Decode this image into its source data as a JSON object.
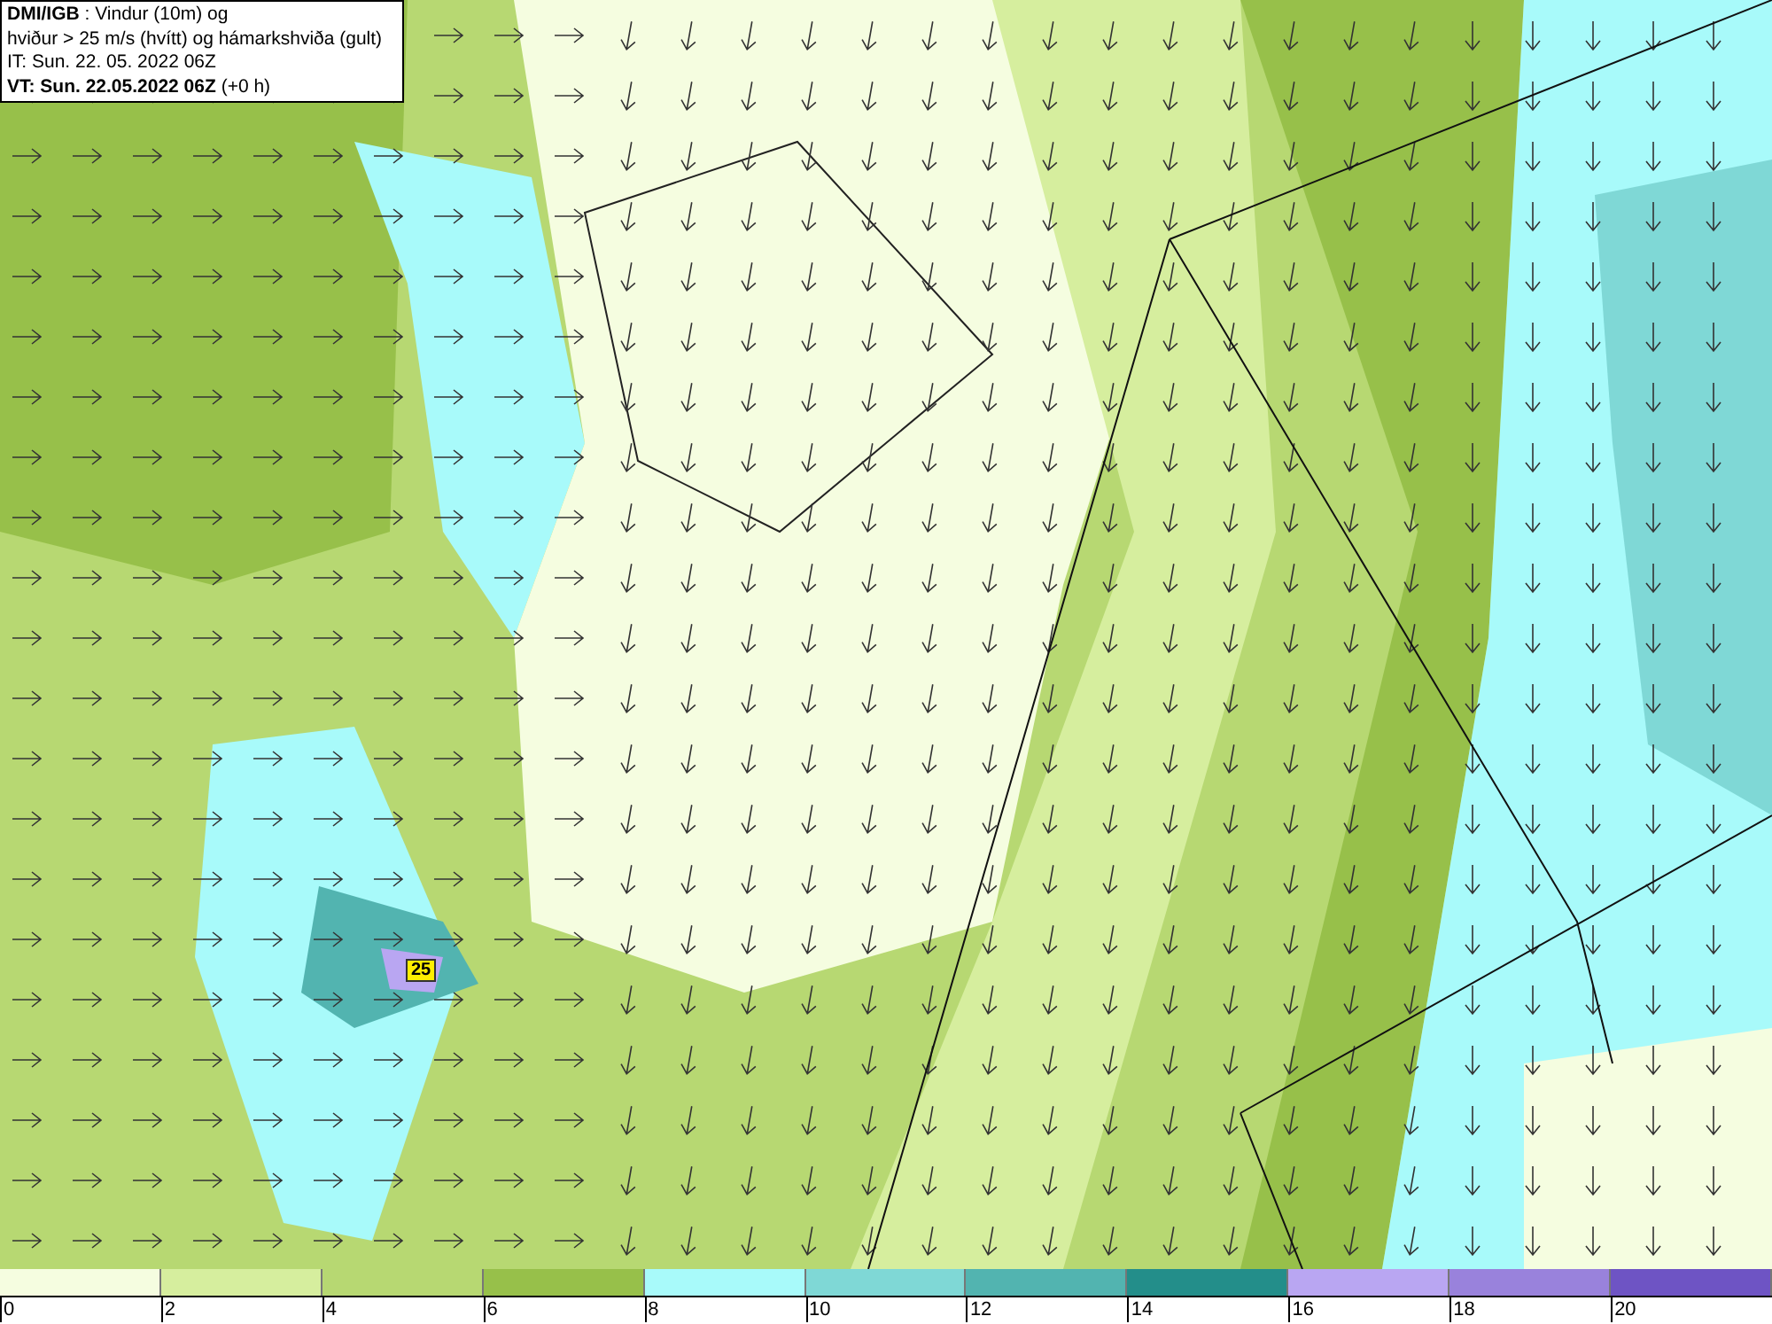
{
  "header": {
    "lines": [
      "**DMI/IGB** : Vindur (10m) og",
      "hviður > 25 m/s (hvítt) og hámarkshviða (gult)",
      "IT: Sun. 22. 05. 2022 06Z",
      "**VT: Sun. 22.05.2022 06Z** (+0 h)"
    ]
  },
  "map": {
    "gust_label": "25"
  },
  "legend": {
    "bins": [
      {
        "color": "#f5fde0"
      },
      {
        "color": "#d6ee9e"
      },
      {
        "color": "#b7d872"
      },
      {
        "color": "#97c04a"
      },
      {
        "color": "#a8fafa"
      },
      {
        "color": "#7fd8d6"
      },
      {
        "color": "#52b4b0"
      },
      {
        "color": "#238e8a"
      },
      {
        "color": "#b9a6f2"
      },
      {
        "color": "#9982dc"
      },
      {
        "color": "#6e54c4"
      }
    ],
    "ticks": [
      "0",
      "2",
      "4",
      "6",
      "8",
      "10",
      "12",
      "14",
      "16",
      "18",
      "20"
    ]
  }
}
